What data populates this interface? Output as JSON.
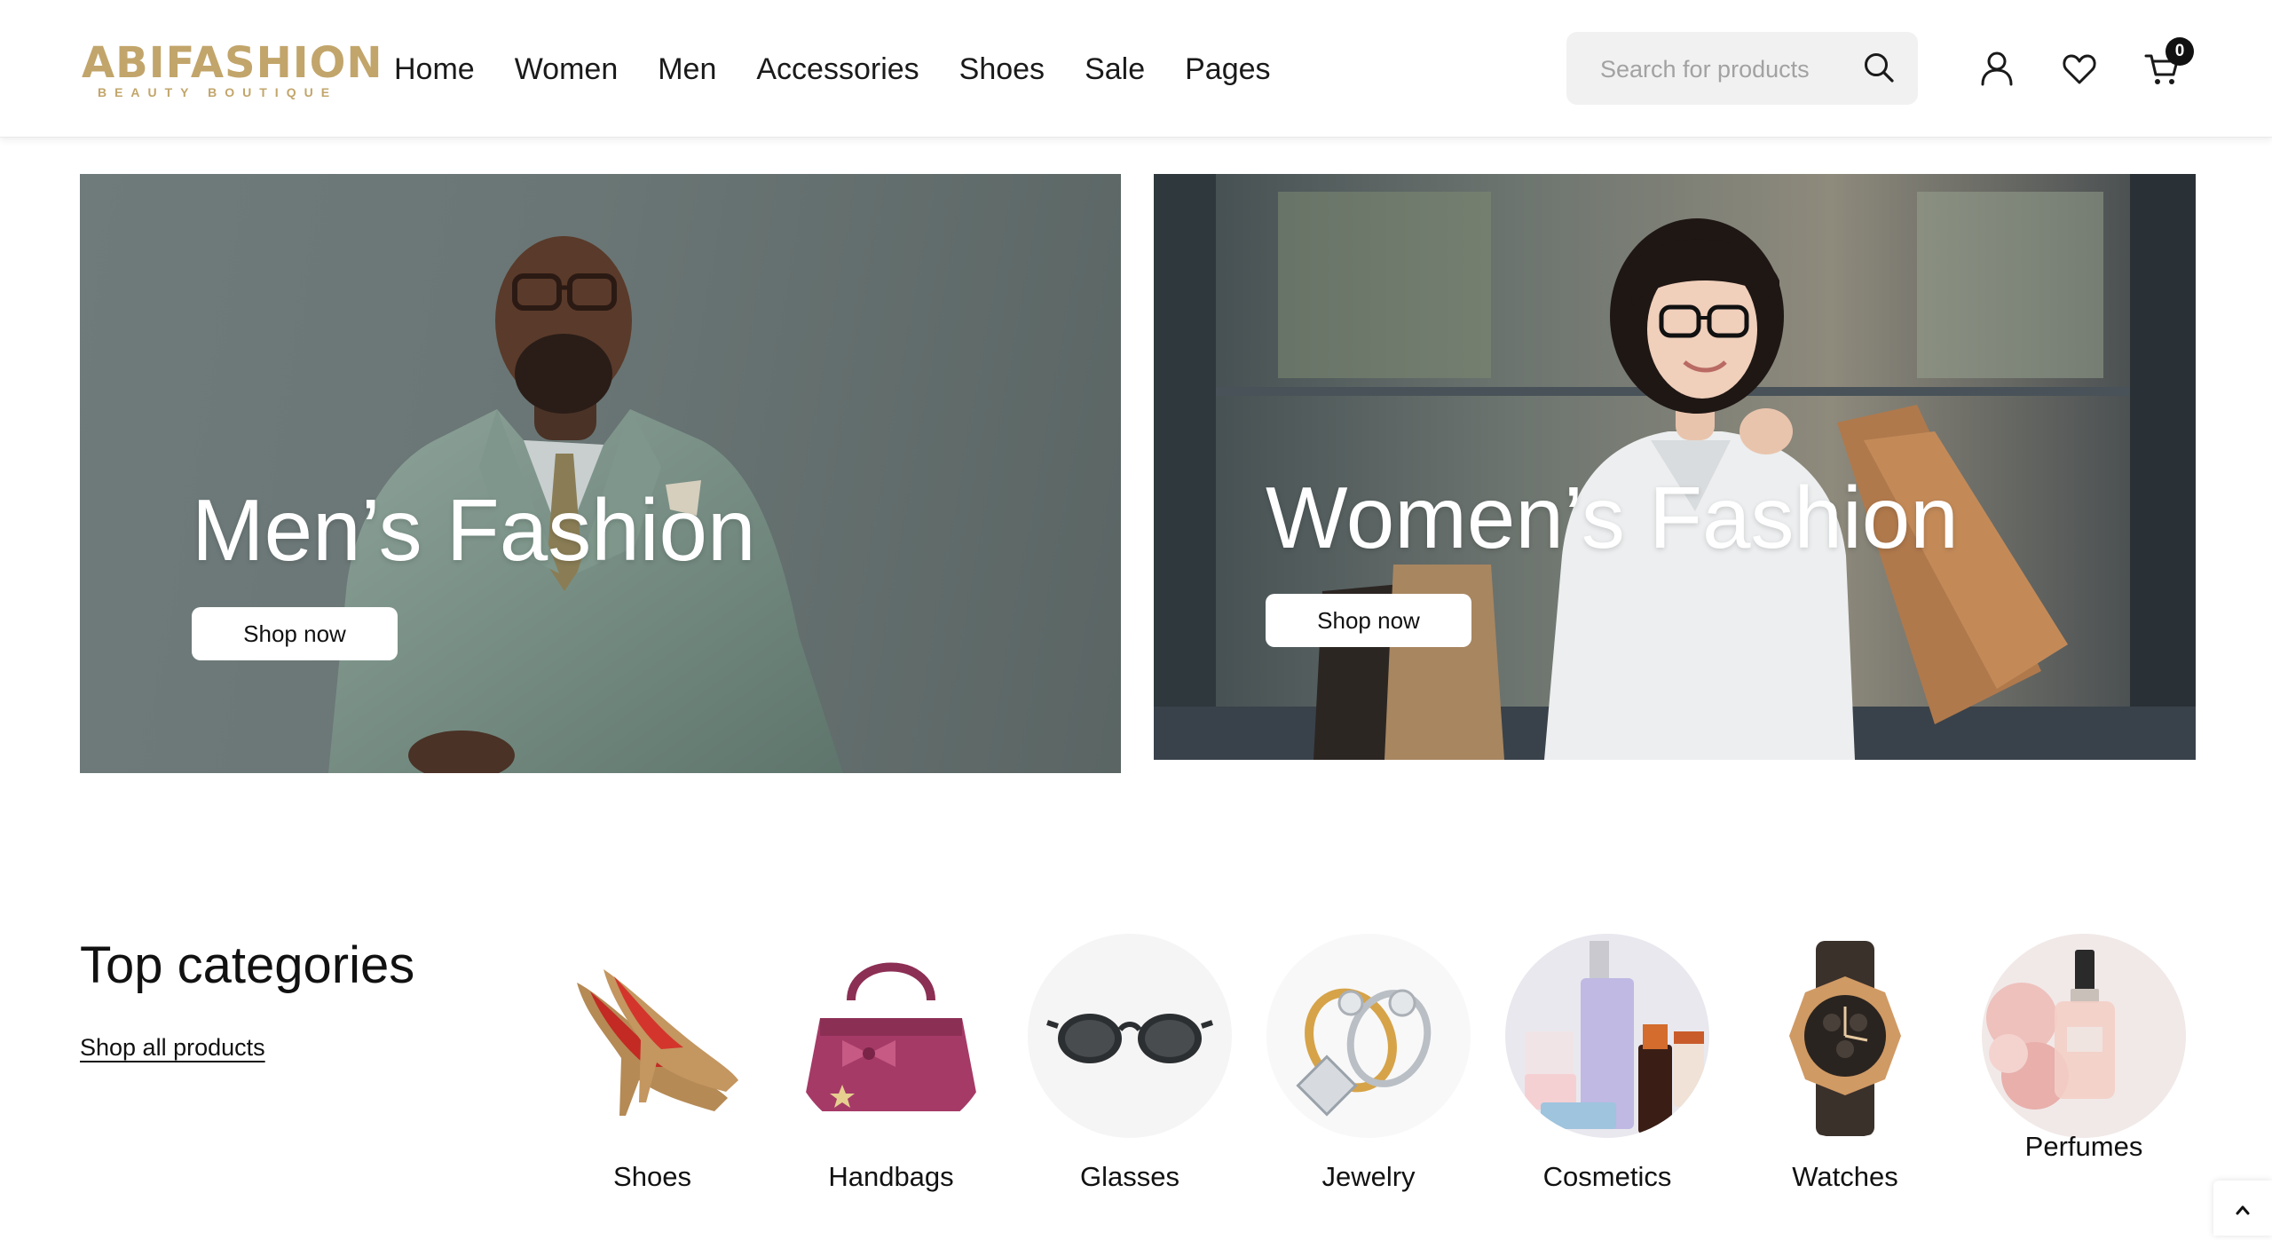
{
  "header": {
    "logo": {
      "name": "ABIFASHION",
      "tagline": "BEAUTY BOUTIQUE"
    },
    "nav": [
      "Home",
      "Women",
      "Men",
      "Accessories",
      "Shoes",
      "Sale",
      "Pages"
    ],
    "search": {
      "placeholder": "Search for products",
      "value": ""
    },
    "icons": [
      "search-icon",
      "user-icon",
      "heart-icon",
      "cart-icon"
    ],
    "cart_count": "0"
  },
  "banners": [
    {
      "title": "Men’s Fashion",
      "button": "Shop now"
    },
    {
      "title": "Women’s Fashion",
      "button": "Shop now"
    }
  ],
  "categories": {
    "title": "Top categories",
    "link": "Shop all products",
    "items": [
      {
        "label": "Shoes",
        "icon": "shoes-image"
      },
      {
        "label": "Handbags",
        "icon": "handbag-image"
      },
      {
        "label": "Glasses",
        "icon": "glasses-image"
      },
      {
        "label": "Jewelry",
        "icon": "rings-image"
      },
      {
        "label": "Cosmetics",
        "icon": "cosmetics-image"
      },
      {
        "label": "Watches",
        "icon": "watch-image"
      },
      {
        "label": "Perfumes",
        "icon": "perfume-image"
      }
    ]
  },
  "colors": {
    "brand": "#c2a56b",
    "text": "#111111",
    "search_bg": "#f1f1f1"
  }
}
